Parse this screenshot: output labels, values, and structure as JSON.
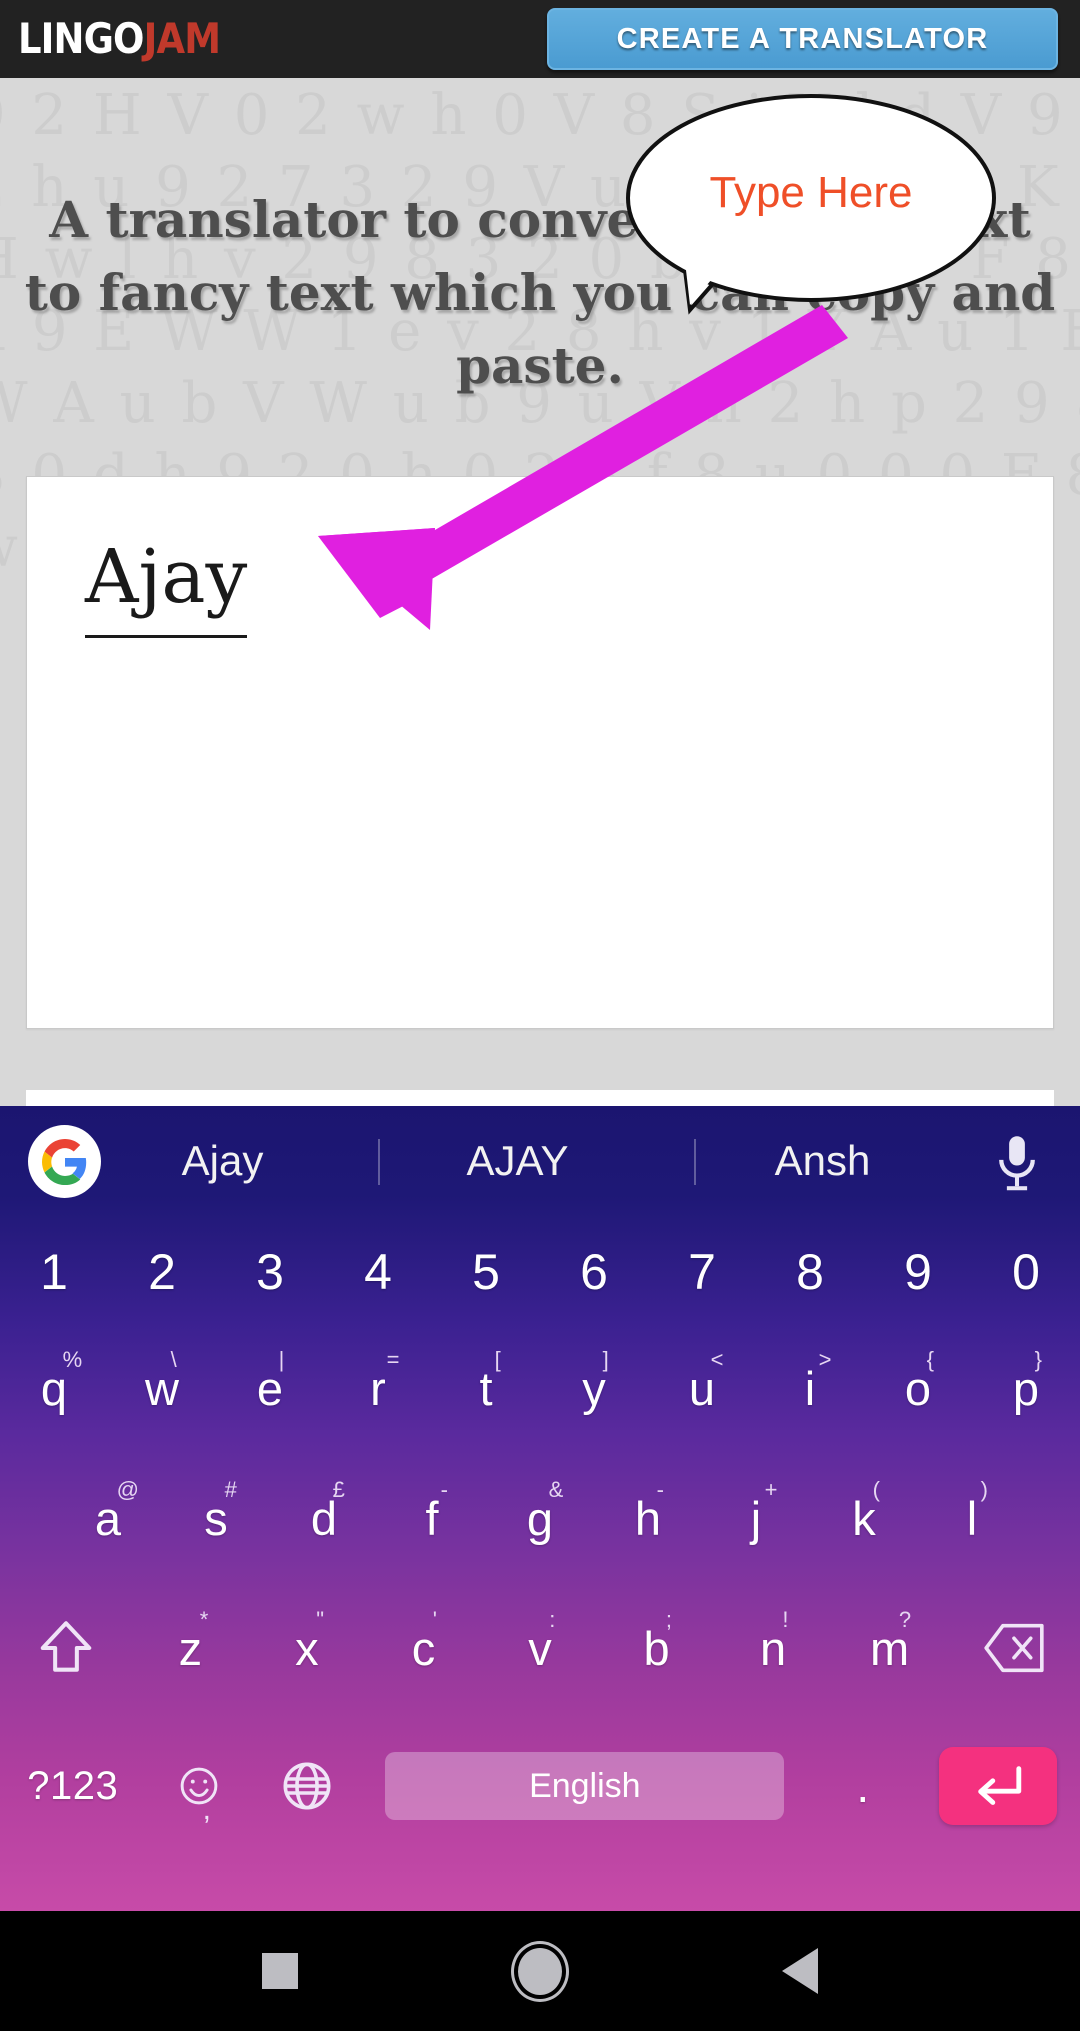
{
  "app": {
    "brand_lingo": "LINGO",
    "brand_jam": "JAM",
    "create_button": "CREATE A TRANSLATOR",
    "accent_blue": "#4a9bd1",
    "accent_red": "#c0392b",
    "accent_magenta": "#e020e0",
    "accent_orange": "#ef4f28"
  },
  "page": {
    "headline": "A translator to convert normal text to fancy text which you can copy and paste.",
    "watermark": "h 2 0 8 2 2 0 D h 0 2 2 F 8 0 0 0 0 0 9 2 H V 0 2 w h 0 V 8 S i V l d V 9 F 2 h u 9 2 7 3 2 9 V u D v K 6 S i K H w l h v 2 9 8 3 2 0 b H 9 2 3 F 8 h 9 E W W 1 e v 2 8 h v 1 Y A u 1 E W A u b V W u b 9 u V h 2 h p 2 9 8 3 0 d h 9 2 0 h 0 2 3 f 8 u 0 0 0 F 8 w u B a 9 V a 9 v a u u t a 9 0 B"
  },
  "callout": {
    "label": "Type Here"
  },
  "input": {
    "value": "Ajay",
    "placeholder": ""
  },
  "keyboard": {
    "suggestions": [
      "Ajay",
      "AJAY",
      "Ansh"
    ],
    "number_row": [
      "1",
      "2",
      "3",
      "4",
      "5",
      "6",
      "7",
      "8",
      "9",
      "0"
    ],
    "row_q": [
      {
        "main": "q",
        "sup": "%"
      },
      {
        "main": "w",
        "sup": "\\"
      },
      {
        "main": "e",
        "sup": "|"
      },
      {
        "main": "r",
        "sup": "="
      },
      {
        "main": "t",
        "sup": "["
      },
      {
        "main": "y",
        "sup": "]"
      },
      {
        "main": "u",
        "sup": "<"
      },
      {
        "main": "i",
        "sup": ">"
      },
      {
        "main": "o",
        "sup": "{"
      },
      {
        "main": "p",
        "sup": "}"
      }
    ],
    "row_a": [
      {
        "main": "a",
        "sup": "@"
      },
      {
        "main": "s",
        "sup": "#"
      },
      {
        "main": "d",
        "sup": "£"
      },
      {
        "main": "f",
        "sup": "-"
      },
      {
        "main": "g",
        "sup": "&"
      },
      {
        "main": "h",
        "sup": "-"
      },
      {
        "main": "j",
        "sup": "+"
      },
      {
        "main": "k",
        "sup": "("
      },
      {
        "main": "l",
        "sup": ")"
      }
    ],
    "row_z": [
      {
        "main": "z",
        "sup": "*"
      },
      {
        "main": "x",
        "sup": "\""
      },
      {
        "main": "c",
        "sup": "'"
      },
      {
        "main": "v",
        "sup": ":"
      },
      {
        "main": "b",
        "sup": ";"
      },
      {
        "main": "n",
        "sup": "!"
      },
      {
        "main": "m",
        "sup": "?"
      }
    ],
    "bottom_row": {
      "symbols_label": "?123",
      "emoji_comma": ",",
      "space_label": "English",
      "period": "."
    },
    "gradient_top": "#1b1570",
    "gradient_bottom": "#c74ba8",
    "enter_key_color": "#f4317f"
  },
  "navbar": {
    "recents": "recents",
    "home": "home",
    "back": "back"
  }
}
